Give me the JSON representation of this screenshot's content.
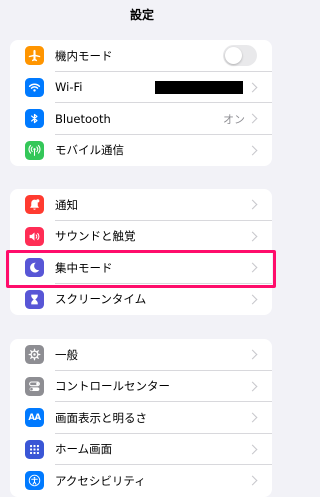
{
  "header": {
    "title": "設定"
  },
  "group1": {
    "airplane": {
      "label": "機内モード",
      "color": "#ff9500",
      "icon": "airplane-icon",
      "toggle_on": false
    },
    "wifi": {
      "label": "Wi-Fi",
      "color": "#007aff",
      "icon": "wifi-icon"
    },
    "bluetooth": {
      "label": "Bluetooth",
      "value": "オン",
      "color": "#007aff",
      "icon": "bluetooth-icon"
    },
    "cellular": {
      "label": "モバイル通信",
      "color": "#34c759",
      "icon": "antenna-icon"
    }
  },
  "group2": {
    "notifications": {
      "label": "通知",
      "color": "#ff3b30",
      "icon": "bell-icon"
    },
    "sounds": {
      "label": "サウンドと触覚",
      "color": "#ff2d55",
      "icon": "speaker-icon"
    },
    "focus": {
      "label": "集中モード",
      "color": "#5856d6",
      "icon": "moon-icon"
    },
    "screentime": {
      "label": "スクリーンタイム",
      "color": "#5856d6",
      "icon": "hourglass-icon"
    }
  },
  "group3": {
    "general": {
      "label": "一般",
      "color": "#8e8e93",
      "icon": "gear-icon"
    },
    "control": {
      "label": "コントロールセンター",
      "color": "#8e8e93",
      "icon": "switches-icon"
    },
    "display": {
      "label": "画面表示と明るさ",
      "color": "#007aff",
      "icon": "text-size-icon",
      "icon_text": "AA"
    },
    "home": {
      "label": "ホーム画面",
      "color": "#3a56d6",
      "icon": "grid-icon"
    },
    "accessibility": {
      "label": "アクセシビリティ",
      "color": "#007aff",
      "icon": "accessibility-icon"
    }
  },
  "highlight_color": "#ff0d6b"
}
